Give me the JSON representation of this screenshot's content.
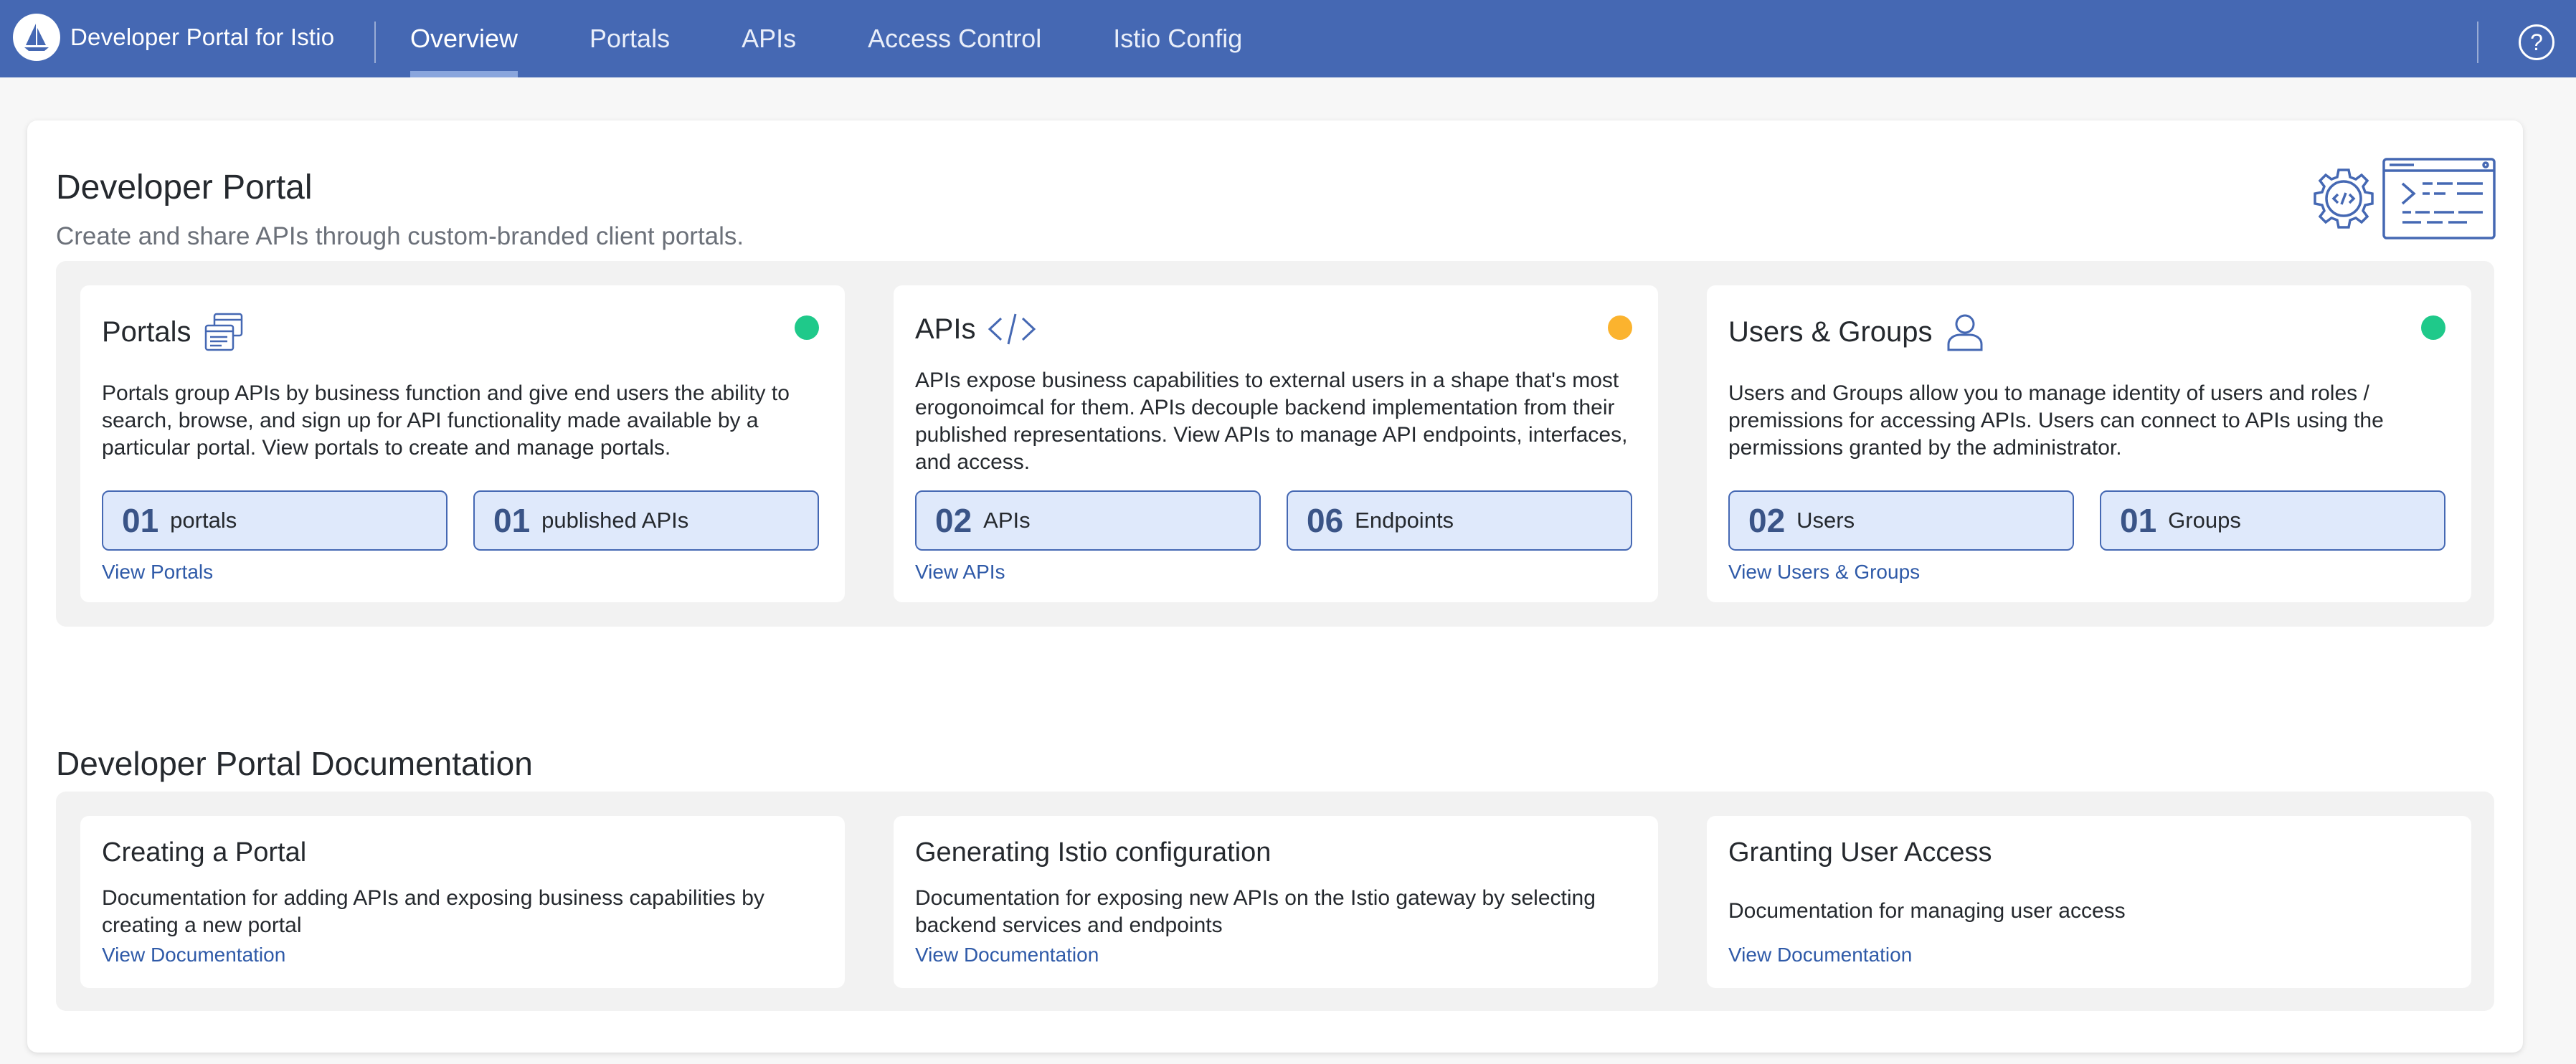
{
  "header": {
    "app_title": "Developer Portal for Istio",
    "tabs": [
      {
        "label": "Overview",
        "active": true
      },
      {
        "label": "Portals"
      },
      {
        "label": "APIs"
      },
      {
        "label": "Access Control"
      },
      {
        "label": "Istio Config"
      }
    ],
    "help_label": "?"
  },
  "hero": {
    "title": "Developer Portal",
    "subtitle": "Create and share APIs through custom-branded client portals.",
    "icons": [
      "gear-code-icon",
      "terminal-window-icon"
    ]
  },
  "cards": [
    {
      "title": "Portals",
      "icon": "portals-icon",
      "status_color": "#1fc98a",
      "description": "Portals group APIs by business function and give end users the ability to search, browse, and sign up for API functionality made available by a particular portal. View portals to create and manage portals.",
      "stats": [
        {
          "num": "01",
          "label": "portals"
        },
        {
          "num": "01",
          "label": "published APIs"
        }
      ],
      "link": "View Portals"
    },
    {
      "title": "APIs",
      "icon": "code-icon",
      "status_color": "#fbb32e",
      "description": "APIs expose business capabilities to external users in a shape that's most erogonoimcal for them. APIs decouple backend implementation from their published representations. View APIs to manage API endpoints, interfaces, and access.",
      "stats": [
        {
          "num": "02",
          "label": "APIs"
        },
        {
          "num": "06",
          "label": "Endpoints"
        }
      ],
      "link": "View APIs"
    },
    {
      "title": "Users & Groups",
      "icon": "user-icon",
      "status_color": "#1fc98a",
      "description": "Users and Groups allow you to manage identity of users and roles / premissions for accessing APIs. Users can connect to APIs using the permissions granted by the administrator.",
      "stats": [
        {
          "num": "02",
          "label": "Users"
        },
        {
          "num": "01",
          "label": "Groups"
        }
      ],
      "link": "View Users & Groups"
    }
  ],
  "docs": {
    "title": "Developer Portal Documentation",
    "items": [
      {
        "title": "Creating a Portal",
        "description": "Documentation for adding APIs and exposing business capabilities by creating a new portal",
        "link": "View Documentation"
      },
      {
        "title": "Generating Istio configuration",
        "description": "Documentation for exposing new APIs on the Istio gateway by selecting backend services and endpoints",
        "link": "View Documentation"
      },
      {
        "title": "Granting User Access",
        "description": "Documentation for managing user access",
        "link": "View Documentation"
      }
    ]
  },
  "colors": {
    "brand": "#4568b3",
    "accent": "#2f5aa8",
    "ok": "#1fc98a",
    "warn": "#fbb32e"
  }
}
